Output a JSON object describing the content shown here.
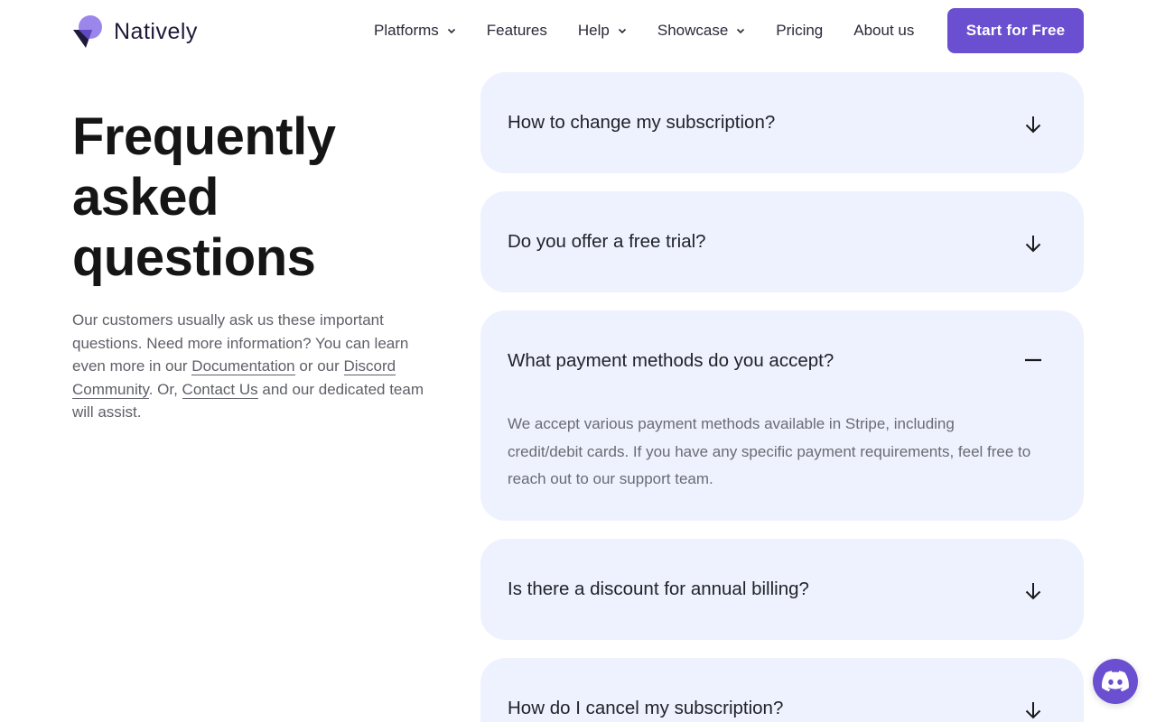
{
  "brand": {
    "name": "Natively",
    "accent": "#6a4fd0",
    "card_bg": "#edf2fe"
  },
  "nav": {
    "items": [
      {
        "label": "Platforms",
        "has_dropdown": true
      },
      {
        "label": "Features",
        "has_dropdown": false
      },
      {
        "label": "Help",
        "has_dropdown": true
      },
      {
        "label": "Showcase",
        "has_dropdown": true
      },
      {
        "label": "Pricing",
        "has_dropdown": false
      },
      {
        "label": "About us",
        "has_dropdown": false
      }
    ],
    "cta_label": "Start for Free"
  },
  "faq": {
    "title_lines": [
      "Frequently",
      "asked",
      "questions"
    ],
    "intro": {
      "t1": "Our customers usually ask us these important questions. Need more information? You can learn even more in our ",
      "link_docs": "Documentation",
      "t2": " or our ",
      "link_discord": "Discord Community",
      "t3": ". Or, ",
      "link_contact": "Contact Us",
      "t4": " and our dedicated team will assist."
    },
    "items": [
      {
        "question": "How to change my subscription?",
        "expanded": false,
        "icon": "arrow-down-icon"
      },
      {
        "question": "Do you offer a free trial?",
        "expanded": false,
        "icon": "arrow-down-icon"
      },
      {
        "question": "What payment methods do you accept?",
        "expanded": true,
        "icon": "minus-icon",
        "answer": "We accept various payment methods available in Stripe, including credit/debit cards. If you have any specific payment requirements, feel free to reach out to our support team."
      },
      {
        "question": "Is there a discount for annual billing?",
        "expanded": false,
        "icon": "arrow-down-icon"
      },
      {
        "question": "How do I cancel my subscription?",
        "expanded": false,
        "icon": "arrow-down-icon"
      }
    ]
  },
  "chat_widget": {
    "icon": "discord-icon"
  }
}
